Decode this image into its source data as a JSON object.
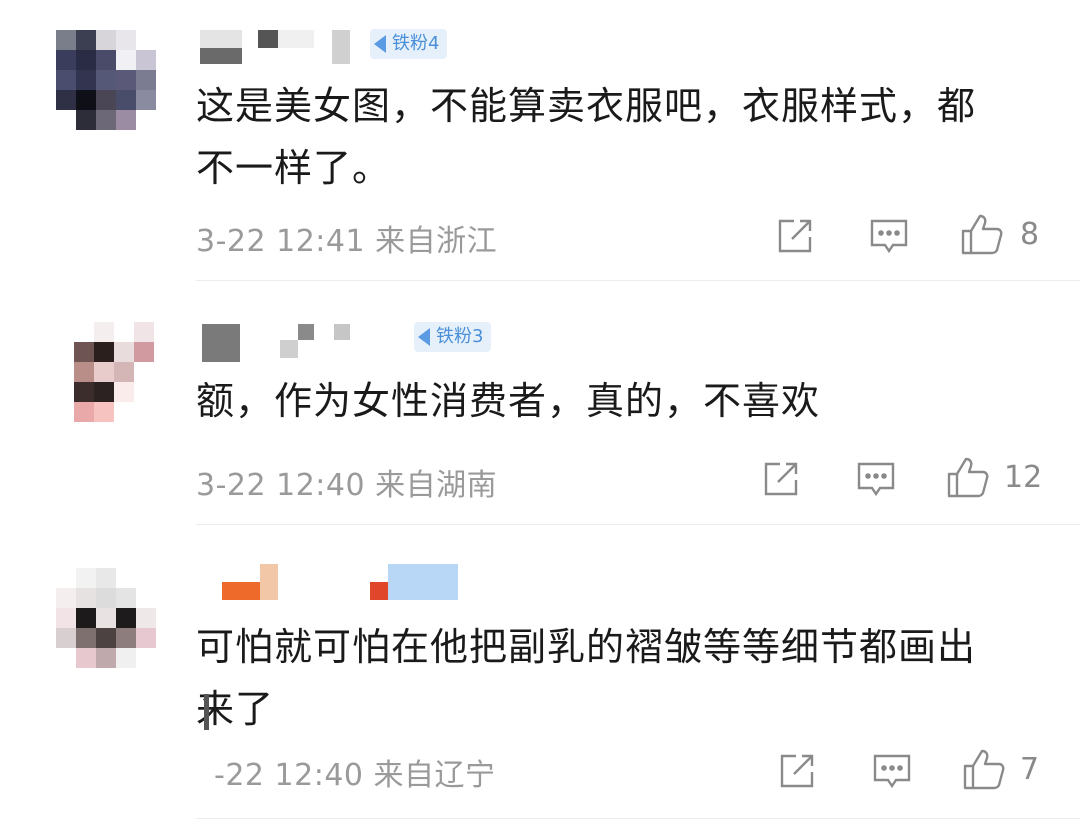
{
  "comments": [
    {
      "badge": "铁粉4",
      "text_line1": "这是美女图，不能算卖衣服吧，衣服样式，都",
      "text_line2": "不一样了。",
      "date": "3-22 12:41",
      "location": "来自浙江",
      "likes": "8"
    },
    {
      "badge": "铁粉3",
      "text_line1": "额，作为女性消费者，真的，不喜欢",
      "text_line2": "",
      "date": "3-22 12:40",
      "location": "来自湖南",
      "likes": "12"
    },
    {
      "badge": "",
      "text_line1": "可怕就可怕在他把副乳的褶皱等等细节都画出",
      "text_line2": "来了",
      "date": "-22 12:40",
      "location": "来自辽宁",
      "likes": "7"
    }
  ],
  "icons": {
    "share": "share-icon",
    "comment": "comment-icon",
    "like": "thumbs-up-icon"
  },
  "colors": {
    "badge_text": "#4a8fd8",
    "badge_bg": "#e6f0fb",
    "meta": "#9a9a9a",
    "text": "#1a1a1a"
  }
}
